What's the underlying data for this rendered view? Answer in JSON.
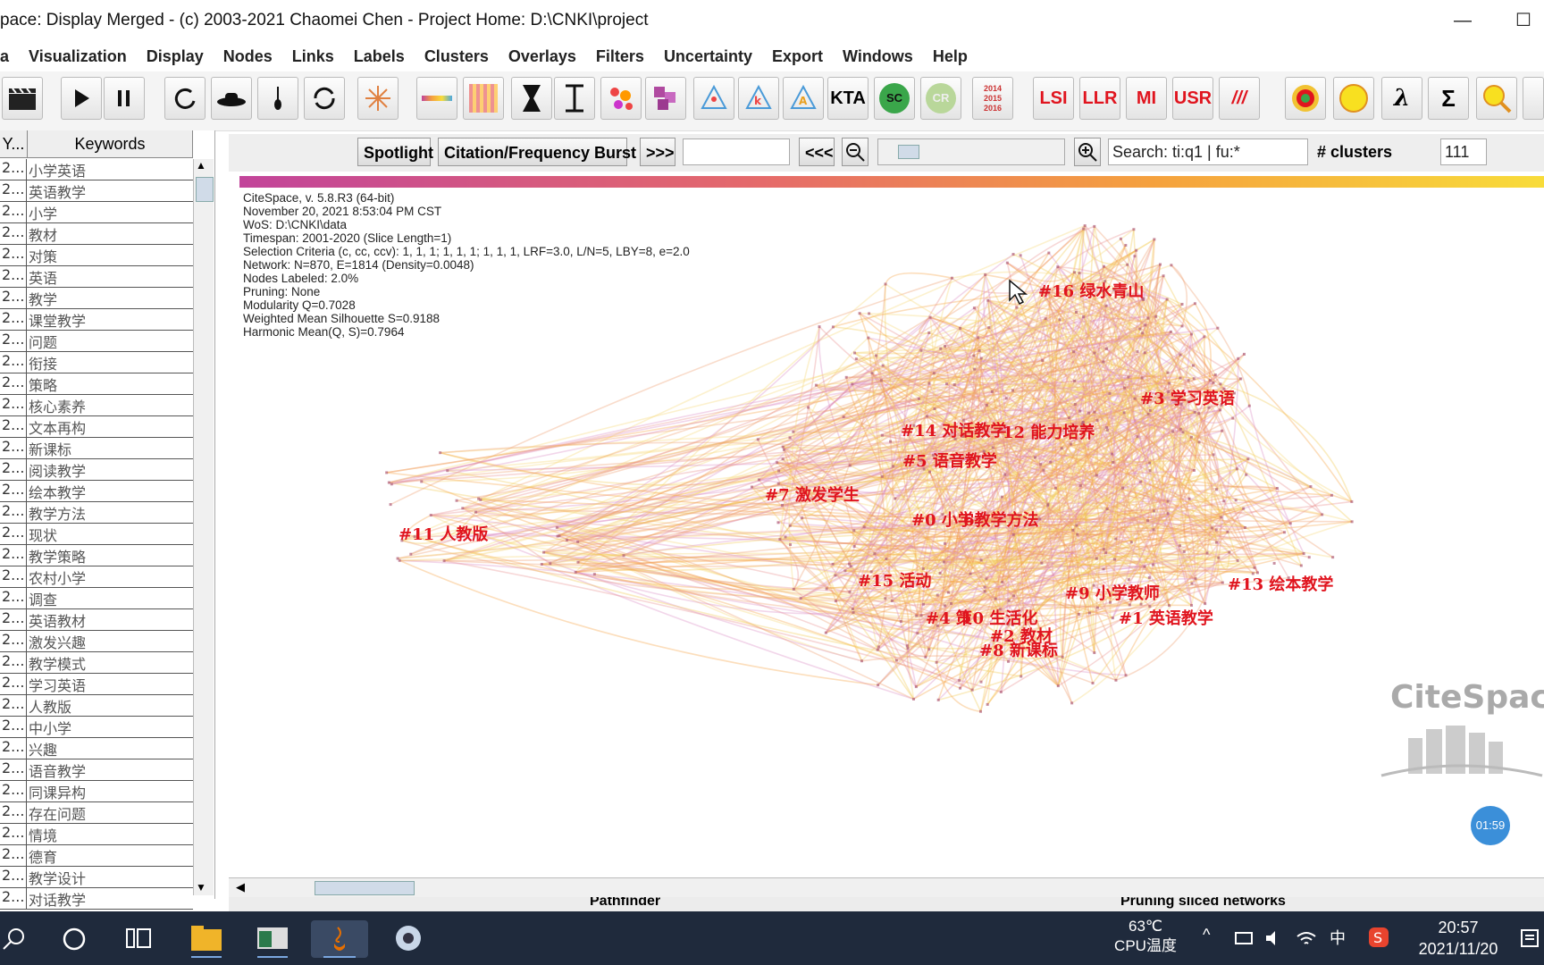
{
  "window": {
    "title": "pace: Display Merged - (c) 2003-2021 Chaomei Chen - Project Home: D:\\CNKI\\project",
    "minimize": "—",
    "maximize": "☐"
  },
  "menu": [
    "a",
    "Visualization",
    "Display",
    "Nodes",
    "Links",
    "Labels",
    "Clusters",
    "Overlays",
    "Filters",
    "Uncertainty",
    "Export",
    "Windows",
    "Help"
  ],
  "toolbar": {
    "slice_years": "2014\n2015\n2016",
    "kta": "KTA",
    "sc": "SC",
    "cr": "CR",
    "lsi": "LSI",
    "llr": "LLR",
    "mi": "MI",
    "usr": "USR",
    "slashes": "///",
    "lambda": "λ",
    "sigma": "Σ"
  },
  "table": {
    "headers": [
      "Y...",
      "Keywords"
    ],
    "year_prefix": "2...",
    "rows": [
      "小学英语",
      "英语教学",
      "小学",
      "教材",
      "对策",
      "英语",
      "教学",
      "课堂教学",
      "问题",
      "衔接",
      "策略",
      "核心素养",
      "文本再构",
      "新课标",
      "阅读教学",
      "绘本教学",
      "教学方法",
      "现状",
      "教学策略",
      "农村小学",
      "调查",
      "英语教材",
      "激发兴趣",
      "教学模式",
      "学习英语",
      "人教版",
      "中小学",
      "兴趣",
      "语音教学",
      "同课异构",
      "存在问题",
      "情境",
      "德育",
      "教学设计",
      "对话教学"
    ]
  },
  "controls": {
    "spotlight": "Spotlight",
    "citation_burst": "Citation/Frequency Burst",
    "next": ">>>",
    "prev": "<<<",
    "search_placeholder": "Search: ti:q1 | fu:*",
    "clusters_label": "# clusters",
    "clusters_value": "111"
  },
  "info": [
    "CiteSpace, v. 5.8.R3 (64-bit)",
    "November 20, 2021 8:53:04 PM CST",
    "WoS: D:\\CNKI\\data",
    "Timespan: 2001-2020 (Slice Length=1)",
    "Selection Criteria (c, cc, ccv): 1, 1, 1; 1, 1, 1; 1, 1, 1, LRF=3.0, L/N=5, LBY=8, e=2.0",
    "Network: N=870, E=1814 (Density=0.0048)",
    "Nodes Labeled: 2.0%",
    "Pruning: None",
    "Modularity Q=0.7028",
    "Weighted Mean Silhouette S=0.9188",
    "Harmonic Mean(Q, S)=0.7964"
  ],
  "clusters": [
    "#16 绿水青山",
    "#3 学习英语",
    "#14 对话教学",
    "12 能力培养",
    "#5 语音教学",
    "#7 激发学生",
    "#0 小学",
    "6教学方法",
    "#11 人教版",
    "#15 活动",
    "#9 小学教师",
    "#13 绘本教学",
    "#4 策",
    "10 生活化",
    "#1 英语教学",
    "#2 教材",
    "#8 新课标"
  ],
  "watermark": "CiteSpace",
  "timer": "01:59",
  "bottom": {
    "pathfinder": "Pathfinder",
    "pruning": "Pruning sliced networks"
  },
  "taskbar": {
    "temp": "63℃",
    "temp_label": "CPU温度",
    "ime": "中",
    "time": "20:57",
    "date": "2021/11/20"
  }
}
